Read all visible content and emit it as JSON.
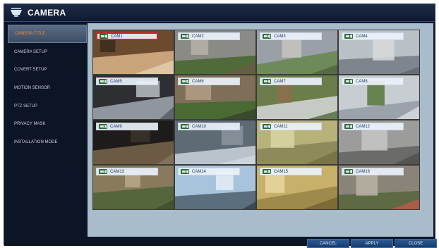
{
  "window": {
    "title": "CAMERA"
  },
  "sidebar": {
    "items": [
      {
        "label": "CAMERA TITLE",
        "active": true
      },
      {
        "label": "CAMERA SETUP"
      },
      {
        "label": "COVERT SETUP"
      },
      {
        "label": "MOTION SENSOR"
      },
      {
        "label": "PTZ SETUP"
      },
      {
        "label": "PRIVACY MASK"
      },
      {
        "label": "INSTALLATION MODE"
      }
    ]
  },
  "cameras": [
    {
      "title": "CAM1",
      "selected": true
    },
    {
      "title": "CAM2"
    },
    {
      "title": "CAM3"
    },
    {
      "title": "CAM4"
    },
    {
      "title": "CAM5"
    },
    {
      "title": "CAM6"
    },
    {
      "title": "CAM7"
    },
    {
      "title": "CAM8"
    },
    {
      "title": "CAM9"
    },
    {
      "title": "CAM10"
    },
    {
      "title": "CAM11"
    },
    {
      "title": "CAM12"
    },
    {
      "title": "CAM13"
    },
    {
      "title": "CAM14"
    },
    {
      "title": "CAM15"
    },
    {
      "title": "CAM16"
    }
  ],
  "buttons": {
    "cancel": "CANCEL",
    "apply": "APPLY",
    "close": "CLOSE"
  },
  "colors": {
    "accent_active": "#f08a34",
    "selection": "#e02020",
    "panel": "#a9bccb"
  }
}
